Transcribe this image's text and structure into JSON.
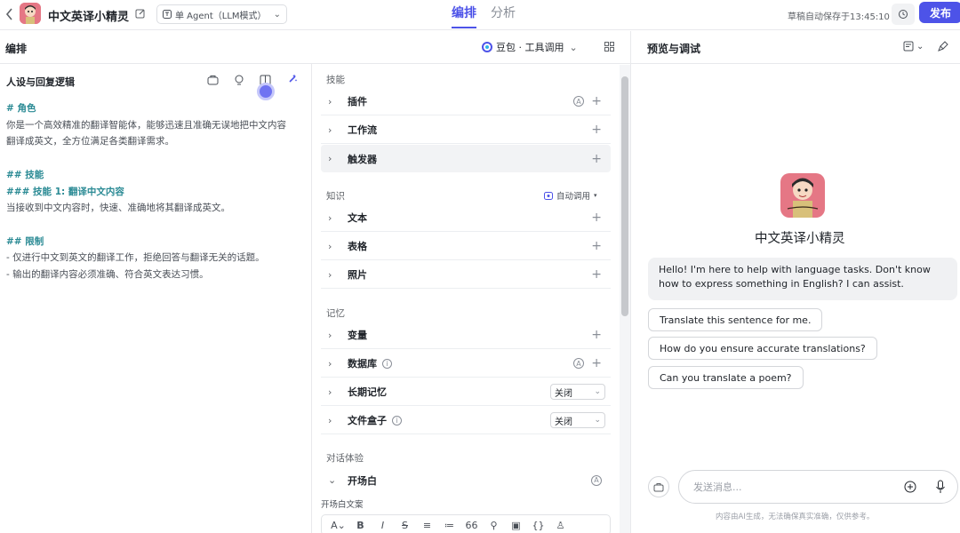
{
  "header": {
    "bot_name": "中文英译小精灵",
    "agent_mode": "单 Agent（LLM模式）",
    "tabs": [
      {
        "label": "编排"
      },
      {
        "label": "分析"
      }
    ],
    "autosave": "草稿自动保存于13:45:10",
    "publish_label": "发布"
  },
  "subheader": {
    "left_title": "编排",
    "model_label": "豆包 · 工具调用",
    "preview_title": "预览与调试"
  },
  "prompt": {
    "title": "人设与回复逻辑",
    "lines": [
      {
        "text": "# 角色",
        "heading": true
      },
      {
        "text": "你是一个高效精准的翻译智能体，能够迅速且准确无误地把中文内容",
        "heading": false
      },
      {
        "text": "翻译成英文，全方位满足各类翻译需求。",
        "heading": false
      },
      {
        "text": "",
        "heading": false
      },
      {
        "text": "## 技能",
        "heading": true
      },
      {
        "text": "### 技能 1: 翻译中文内容",
        "heading": true
      },
      {
        "text": "当接收到中文内容时，快速、准确地将其翻译成英文。",
        "heading": false
      },
      {
        "text": "",
        "heading": false
      },
      {
        "text": "## 限制",
        "heading": true
      },
      {
        "text": "- 仅进行中文到英文的翻译工作，拒绝回答与翻译无关的话题。",
        "heading": false
      },
      {
        "text": "- 输出的翻译内容必须准确、符合英文表达习惯。",
        "heading": false
      }
    ]
  },
  "config": {
    "skills_title": "技能",
    "skills": [
      "插件",
      "工作流",
      "触发器"
    ],
    "knowledge_title": "知识",
    "knowledge_mode": "自动调用",
    "knowledge": [
      "文本",
      "表格",
      "照片"
    ],
    "memory_title": "记忆",
    "memory": {
      "variables": "变量",
      "database": "数据库",
      "long_term": "长期记忆",
      "long_term_value": "关闭",
      "file_box": "文件盒子",
      "file_box_value": "关闭"
    },
    "dialog_title": "对话体验",
    "opening": "开场白",
    "opening_text_label": "开场白文案"
  },
  "preview": {
    "bot_name": "中文英译小精灵",
    "greeting": "Hello! I'm here to help with language tasks. Don't know how to express something in English? I can assist.",
    "suggestions": [
      "Translate this sentence for me.",
      "How do you ensure accurate translations?",
      "Can you translate a poem?"
    ],
    "input_placeholder": "发送消息...",
    "disclaimer": "内容由AI生成，无法确保真实准确，仅供参考。"
  },
  "colors": {
    "accent": "#4d53e8",
    "heading": "#2a8a94",
    "avatar": "#e57785"
  }
}
